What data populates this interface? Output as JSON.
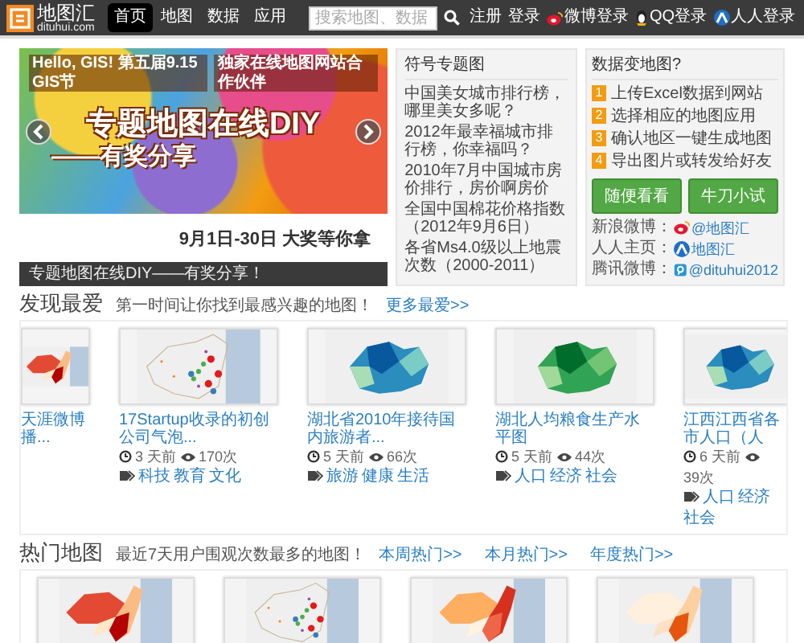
{
  "header": {
    "logo": {
      "name": "地图汇",
      "domain": "dituhui.com"
    },
    "nav": [
      {
        "label": "首页",
        "selected": true
      },
      {
        "label": "地图",
        "selected": false
      },
      {
        "label": "数据",
        "selected": false
      },
      {
        "label": "应用",
        "selected": false
      }
    ],
    "search": {
      "placeholder": "搜索地图、数据"
    },
    "links": [
      {
        "label": "注册",
        "kind": "plain"
      },
      {
        "label": "登录",
        "kind": "plain"
      },
      {
        "label": "微博登录",
        "kind": "weibo"
      },
      {
        "label": "QQ登录",
        "kind": "qq"
      },
      {
        "label": "人人登录",
        "kind": "renren"
      }
    ]
  },
  "banner": {
    "tag_left": "Hello, GIS! 第五届9.15 GIS节",
    "tag_right": "独家在线地图网站合作伙伴",
    "title": "专题地图在线DIY",
    "subtitle": "——有奖分享",
    "date_line": "9月1日-30日  大奖等你拿",
    "caption": "专题地图在线DIY——有奖分享！"
  },
  "topics": {
    "title": "符号专题图",
    "items": [
      "中国美女城市排行榜，哪里美女多呢？",
      "2012年最幸福城市排行榜，你幸福吗？",
      "2010年7月中国城市房价排行，房价啊房价",
      "全国中国棉花价格指数（2012年9月6日）",
      "各省Ms4.0级以上地震次数（2000-2011）"
    ]
  },
  "guide": {
    "title": "数据变地图?",
    "steps": [
      {
        "number": "1",
        "label": "上传Excel数据到网站"
      },
      {
        "number": "2",
        "label": "选择相应的地图应用"
      },
      {
        "number": "3",
        "label": "确认地区一键生成地图"
      },
      {
        "number": "4",
        "label": "导出图片或转发给好友"
      }
    ],
    "buttons": [
      "随便看看",
      "牛刀小试"
    ],
    "socials": [
      {
        "label": "新浪微博：",
        "handle": "@地图汇",
        "kind": "weibo"
      },
      {
        "label": "人人主页：",
        "handle": "地图汇",
        "kind": "renren"
      },
      {
        "label": "腾讯微博：",
        "handle": "@dituhui2012",
        "kind": "tencent"
      }
    ]
  },
  "discover": {
    "title": "发现最爱",
    "subtitle": "第一时间让你找到最感兴趣的地图！",
    "more": "更多最爱>>",
    "cards": [
      {
        "kind": "choropleth-red",
        "title": "天涯微博播..."
      },
      {
        "kind": "bubble",
        "title": "17Startup收录的初创公司气泡...",
        "age": "3 天前",
        "views": "170次",
        "tags": [
          "科技",
          "教育",
          "文化"
        ]
      },
      {
        "kind": "choropleth-blue",
        "title": "湖北省2010年接待国内旅游者...",
        "age": "5 天前",
        "views": "66次",
        "tags": [
          "旅游",
          "健康",
          "生活"
        ]
      },
      {
        "kind": "choropleth-green",
        "title": "湖北人均粮食生产水平图",
        "age": "5 天前",
        "views": "44次",
        "tags": [
          "人口",
          "经济",
          "社会"
        ]
      },
      {
        "kind": "choropleth-blue",
        "title": "江西江西省各市人口（人",
        "age": "6 天前",
        "views": "39次",
        "tags": [
          "人口",
          "经济",
          "社会"
        ]
      }
    ]
  },
  "hot": {
    "title": "热门地图",
    "subtitle": "最近7天用户围观次数最多的地图！",
    "links": [
      "本周热门>>",
      "本月热门>>",
      "年度热门>>"
    ],
    "cards": [
      {
        "kind": "choropleth-red"
      },
      {
        "kind": "bubble"
      },
      {
        "kind": "choropleth-orange"
      },
      {
        "kind": "choropleth-pale"
      }
    ]
  }
}
